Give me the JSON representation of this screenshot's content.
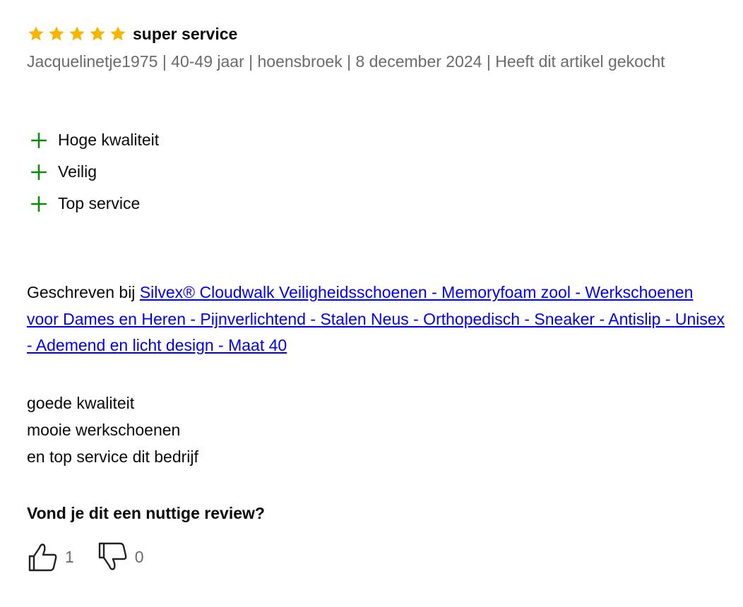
{
  "review": {
    "rating": 5,
    "star_color": "#f7b500",
    "title": "super service",
    "meta": "Jacquelinetje1975 | 40-49 jaar | hoensbroek | 8 december 2024 | Heeft dit artikel gekocht",
    "pros": [
      {
        "icon": "plus-icon",
        "label": "Hoge kwaliteit"
      },
      {
        "icon": "plus-icon",
        "label": "Veilig"
      },
      {
        "icon": "plus-icon",
        "label": "Top service"
      }
    ],
    "plus_color": "#0a8a0a",
    "written_prefix": "Geschreven bij ",
    "product_link": "Silvex® Cloudwalk Veiligheidsschoenen - Memoryfoam zool - Werkschoenen voor Dames en Heren - Pijnverlichtend - Stalen Neus - Orthopedisch - Sneaker - Antislip - Unisex - Ademend en licht design - Maat 40",
    "body_lines": [
      "goede kwaliteit",
      "mooie werkschoenen",
      "en top service dit bedrijf"
    ]
  },
  "feedback": {
    "question": "Vond je dit een nuttige review?",
    "thumbs_up_icon": "thumbs-up-icon",
    "thumbs_down_icon": "thumbs-down-icon",
    "helpful_count": "1",
    "not_helpful_count": "0"
  }
}
